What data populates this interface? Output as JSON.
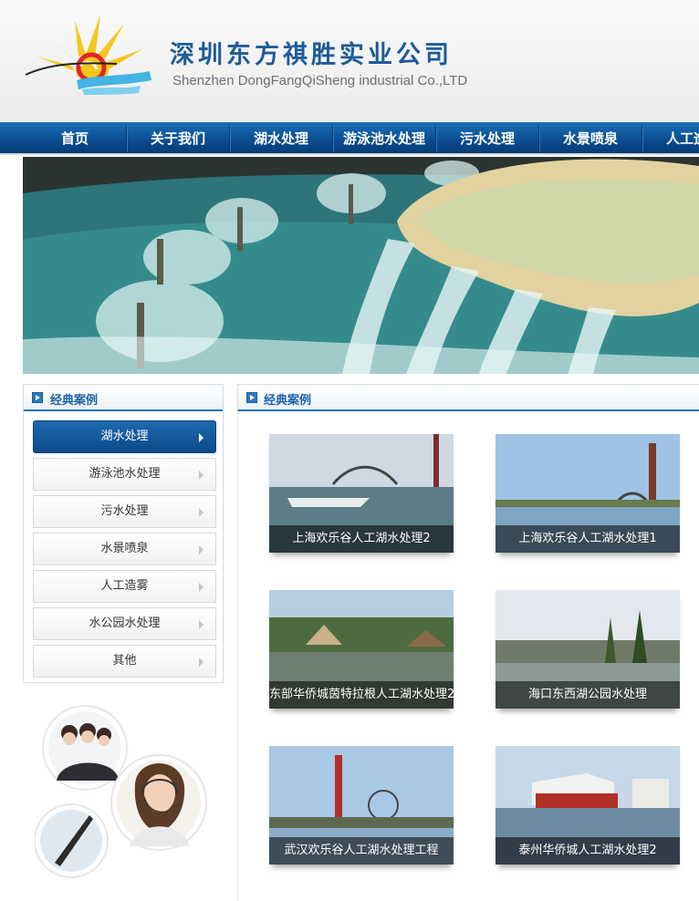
{
  "header": {
    "company_name_cn": "深圳东方祺胜实业公司",
    "company_name_en": "Shenzhen DongFangQiSheng industrial Co.,LTD"
  },
  "nav": {
    "items": [
      "首页",
      "关于我们",
      "湖水处理",
      "游泳池水处理",
      "污水处理",
      "水景喷泉",
      "人工造"
    ]
  },
  "sidebar": {
    "title": "经典案例",
    "categories": [
      "湖水处理",
      "游泳池水处理",
      "污水处理",
      "水景喷泉",
      "人工造雾",
      "水公园水处理",
      "其他"
    ],
    "active_index": 0
  },
  "main": {
    "title": "经典案例",
    "cases": [
      {
        "caption": "上海欢乐谷人工湖水处理2"
      },
      {
        "caption": "上海欢乐谷人工湖水处理1"
      },
      {
        "caption": "东部华侨城茵特拉根人工湖水处理2"
      },
      {
        "caption": "海口东西湖公园水处理"
      },
      {
        "caption": "武汉欢乐谷人工湖水处理工程"
      },
      {
        "caption": "泰州华侨城人工湖水处理2"
      }
    ]
  },
  "colors": {
    "brand_blue": "#1d5b98",
    "nav_blue": "#0b4f93",
    "accent_blue": "#1a64a8"
  }
}
